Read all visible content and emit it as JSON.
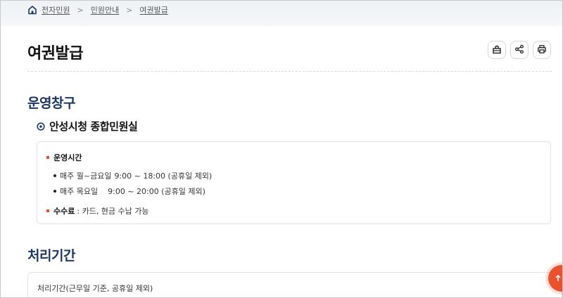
{
  "breadcrumb": {
    "items": [
      "전자민원",
      "민원안내",
      "여권발급"
    ],
    "separator": ">"
  },
  "page": {
    "title": "여권발급"
  },
  "tools": {
    "icons": [
      "share-box-icon",
      "share-icon",
      "print-icon"
    ]
  },
  "sections": {
    "operation": {
      "title": "운영창구",
      "office_name": "안성시청 종합민원실",
      "hours_label": "운영시간",
      "hours": [
        {
          "days": "매주 월~금요일",
          "time": "9:00 ~ 18:00 (공휴일 제외)"
        },
        {
          "days": "매주 목요일",
          "time": "9:00 ~ 20:00 (공휴일 제외)"
        }
      ],
      "fee_label": "수수료",
      "fee_text": ": 카드, 현금 수납 가능"
    },
    "processing": {
      "title": "처리기간",
      "text": "처리기간(근무일 기준, 공휴일 제외)"
    }
  },
  "colors": {
    "accent": "#e8532e",
    "section_title": "#1c3766",
    "bullet_square": "#e2502f"
  }
}
